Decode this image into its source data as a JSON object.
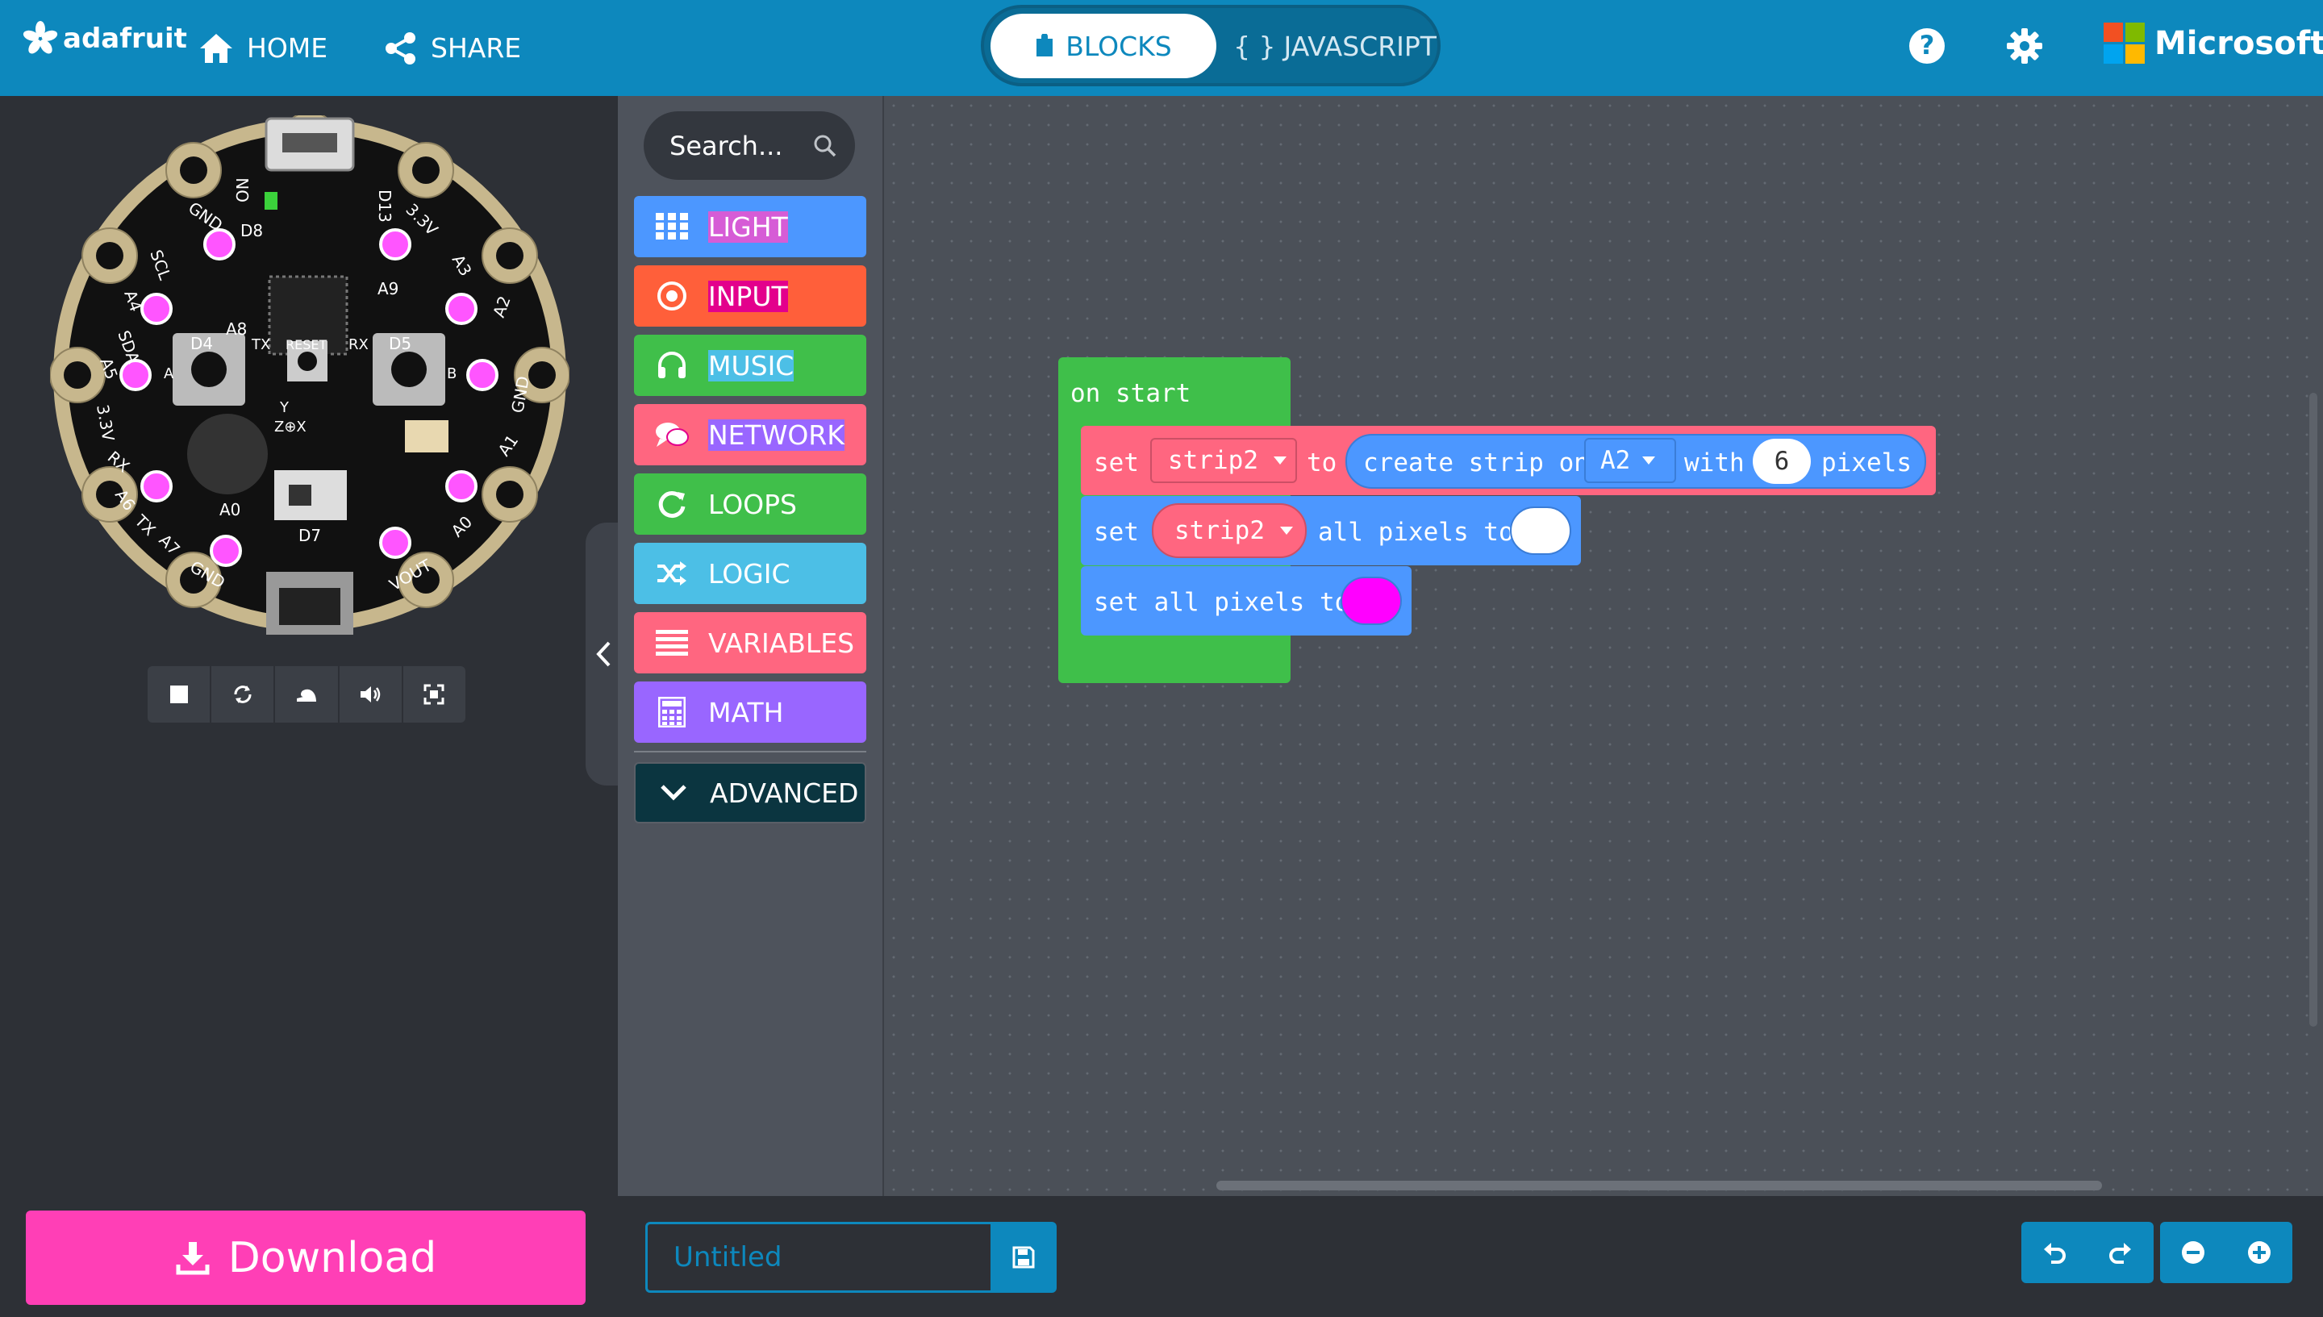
{
  "header": {
    "brand": "adafruit",
    "home_label": "HOME",
    "share_label": "SHARE",
    "mode_blocks_label": "BLOCKS",
    "mode_js_label": "JAVASCRIPT",
    "mode_js_glyph": "{ }",
    "help_glyph": "?",
    "vendor": "Microsoft"
  },
  "simulator": {
    "board_labels": {
      "on": "ON",
      "d13": "D13",
      "gnd_tl": "GND",
      "d8": "D8",
      "v33_tr": "3.3V",
      "scl": "SCL",
      "a3": "A3",
      "a9": "A9",
      "a4": "A4",
      "a8": "A8",
      "sda": "SDA",
      "a2": "A2",
      "a5": "A5",
      "d4": "D4",
      "tx": "TX",
      "reset": "RESET",
      "rx": "RX",
      "d5": "D5",
      "v33_l": "3.3V",
      "gnd_r": "GND",
      "btn_a": "A",
      "btn_b": "B",
      "rx_l": "RX",
      "a1": "A1",
      "y": "Y",
      "zx": "Z⊕X",
      "a6": "A6",
      "a0": "A0",
      "tx_l": "TX",
      "a7": "A7",
      "d7": "D7",
      "gnd_b": "GND",
      "vout": "VOUT",
      "a0_r": "A0"
    },
    "download_label": "Download"
  },
  "toolbox": {
    "search_placeholder": "Search...",
    "categories": [
      {
        "label": "LIGHT",
        "color": "#4c97ff"
      },
      {
        "label": "INPUT",
        "color": "#d65cd6"
      },
      {
        "label": "MUSIC",
        "color": "#ff5f3a"
      },
      {
        "label": "NETWORK",
        "color": "#e3008c"
      },
      {
        "label": "LOOPS",
        "color": "#40bf4a"
      },
      {
        "label": "LOGIC",
        "color": "#4cbfe6"
      },
      {
        "label": "VARIABLES",
        "color": "#ff6680"
      },
      {
        "label": "MATH",
        "color": "#9966ff"
      }
    ],
    "advanced_label": "ADVANCED"
  },
  "workspace": {
    "on_start": "on start",
    "set": "set",
    "var_name": "strip2",
    "to": "to",
    "create_strip_on": "create strip on",
    "pin": "A2",
    "with": "with",
    "pixel_count": "6",
    "pixels": "pixels",
    "all_pixels_to": "all pixels to",
    "set_all_pixels_to": "set all pixels to",
    "color_white": "#ffffff",
    "color_magenta": "#ff00ff"
  },
  "bottom": {
    "project_name_placeholder": "Untitled"
  }
}
